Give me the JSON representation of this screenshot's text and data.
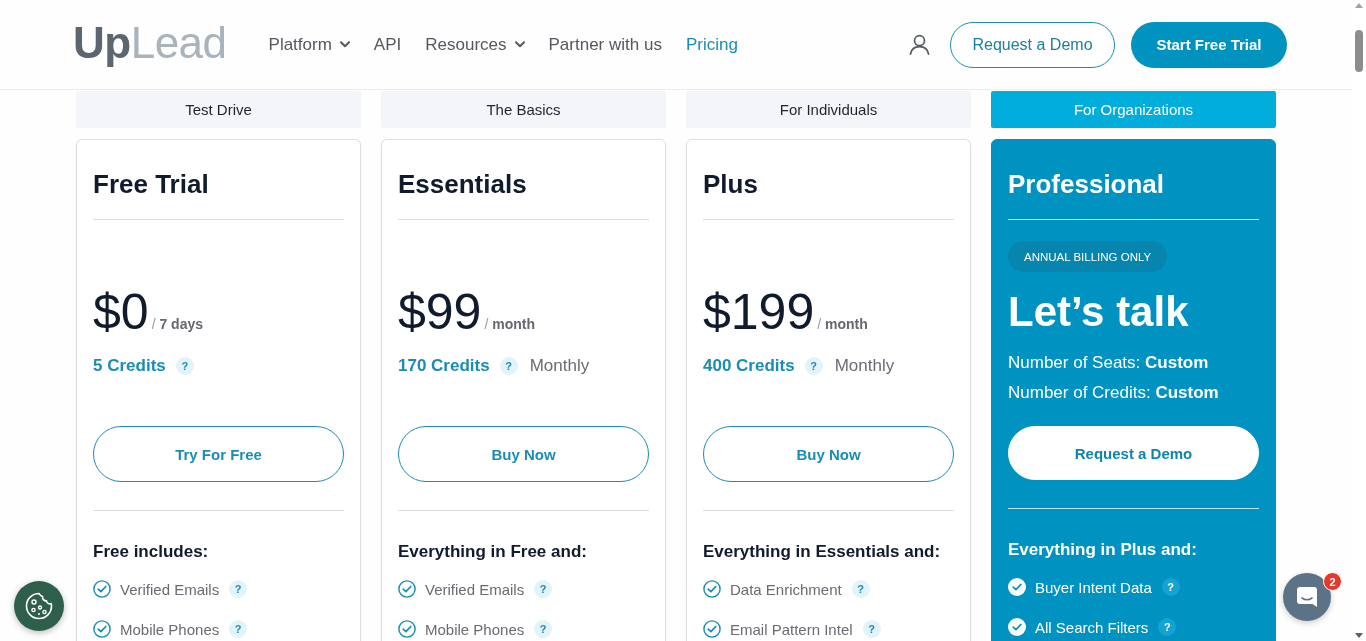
{
  "header": {
    "logo": [
      "Up",
      "Lead"
    ],
    "nav": [
      {
        "label": "Platform",
        "dropdown": true,
        "selected": false
      },
      {
        "label": "API",
        "dropdown": false,
        "selected": false
      },
      {
        "label": "Resources",
        "dropdown": true,
        "selected": false
      },
      {
        "label": "Partner with us",
        "dropdown": false,
        "selected": false
      },
      {
        "label": "Pricing",
        "dropdown": false,
        "selected": true
      }
    ],
    "buttons": [
      {
        "label": "Request a Demo",
        "kind": "outline"
      },
      {
        "label": "Start Free Trial",
        "kind": "solid"
      }
    ]
  },
  "plans": [
    {
      "tier": "Test Drive",
      "highlighted": false,
      "name": "Free Trial",
      "price": "$0",
      "period": "/ **7 days**",
      "credits": "5 Credits",
      "credits_help": "?",
      "button": "Try For Free",
      "features_heading": "Free includes:",
      "features": [
        {
          "label": "Verified Emails",
          "help": "?"
        },
        {
          "label": "Mobile Phones",
          "help": "?"
        }
      ]
    },
    {
      "tier": "The Basics",
      "highlighted": false,
      "name": "Essentials",
      "price": "$99",
      "period": "/ **month**",
      "credits": "170 Credits",
      "credits_help": "?",
      "billing": "Monthly",
      "button": "Buy Now",
      "features_heading": "Everything in Free and:",
      "features": [
        {
          "label": "Verified Emails",
          "help": "?"
        },
        {
          "label": "Mobile Phones",
          "help": "?"
        }
      ]
    },
    {
      "tier": "For Individuals",
      "highlighted": false,
      "name": "Plus",
      "price": "$199",
      "period": "/ **month**",
      "credits": "400 Credits",
      "credits_help": "?",
      "billing": "Monthly",
      "button": "Buy Now",
      "features_heading": "Everything in Essentials and:",
      "features": [
        {
          "label": "Data Enrichment",
          "help": "?"
        },
        {
          "label": "Email Pattern Intel",
          "help": "?"
        }
      ]
    },
    {
      "tier": "For Organizations",
      "highlighted": true,
      "name": "Professional",
      "badge": "ANNUAL BILLING ONLY",
      "price": "Let’s talk",
      "details": [
        "Number of Seats: **Custom**",
        "Number of Credits: **Custom**"
      ],
      "button": "Request a Demo",
      "features_heading": "Everything in Plus and:",
      "features": [
        {
          "label": "Buyer Intent Data",
          "help": "?"
        },
        {
          "label": "All Search Filters",
          "help": "?"
        }
      ]
    }
  ],
  "chat": {
    "badge": "2"
  }
}
